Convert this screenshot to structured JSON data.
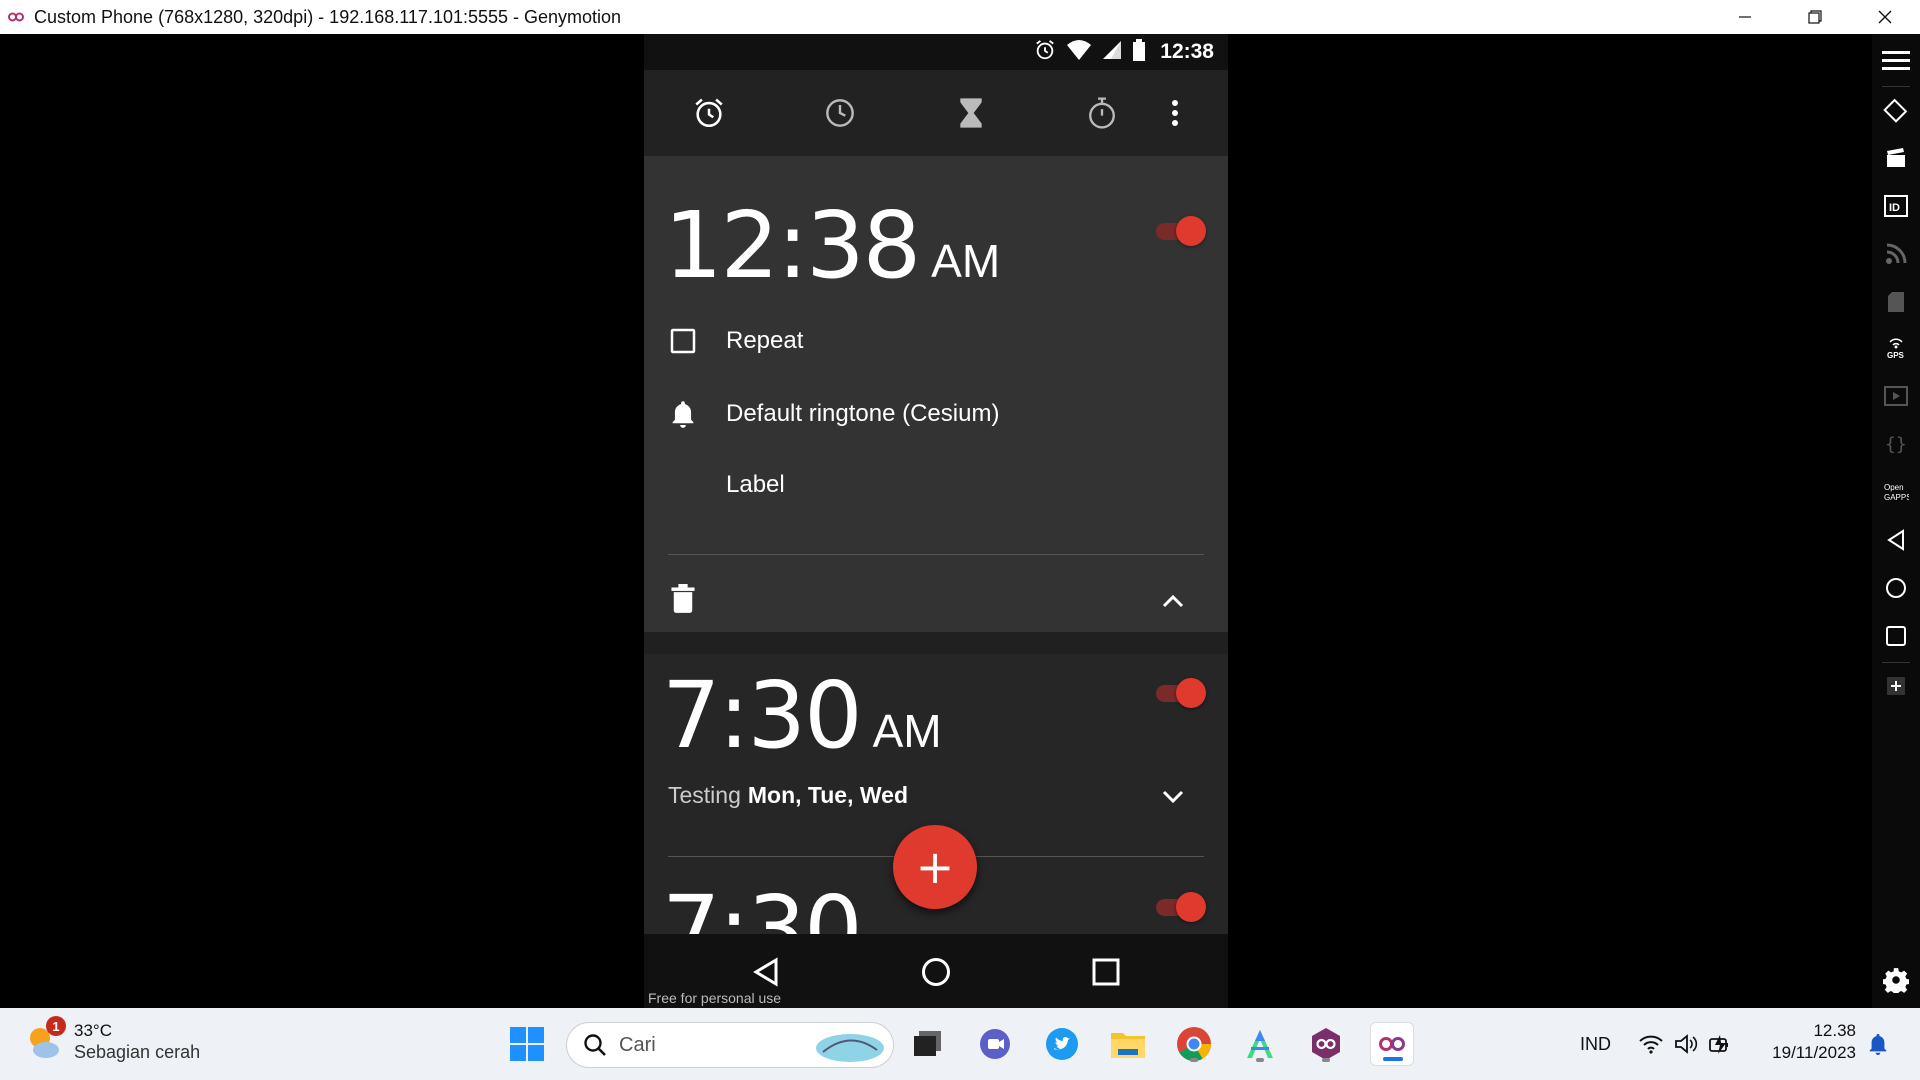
{
  "window": {
    "title": "Custom Phone (768x1280, 320dpi) - 192.168.117.101:5555 - Genymotion"
  },
  "status_bar": {
    "time": "12:38",
    "icons": [
      "alarm-icon",
      "wifi-icon",
      "signal-icon",
      "battery-icon"
    ]
  },
  "clock_tabs": [
    "alarm-tab",
    "clock-tab",
    "timer-tab",
    "stopwatch-tab",
    "more-menu"
  ],
  "alarms": [
    {
      "time": "12:38",
      "ampm": "AM",
      "enabled": true,
      "expanded": true,
      "repeat_label": "Repeat",
      "repeat_checked": false,
      "ringtone": "Default ringtone (Cesium)",
      "label_placeholder": "Label"
    },
    {
      "time": "7:30",
      "ampm": "AM",
      "enabled": true,
      "expanded": false,
      "label": "Testing",
      "days": "Mon, Tue, Wed"
    },
    {
      "time": "7:30",
      "enabled": true,
      "partially_visible": true
    }
  ],
  "fab_label": "+",
  "watermark": "Free for personal use",
  "colors": {
    "accent": "#e0392e",
    "card_expanded": "#333333",
    "card": "#262626"
  },
  "taskbar": {
    "weather": {
      "temp": "33°C",
      "desc": "Sebagian cerah",
      "badge": "1"
    },
    "search_placeholder": "Cari",
    "language": "IND",
    "time": "12.38",
    "date": "19/11/2023"
  }
}
